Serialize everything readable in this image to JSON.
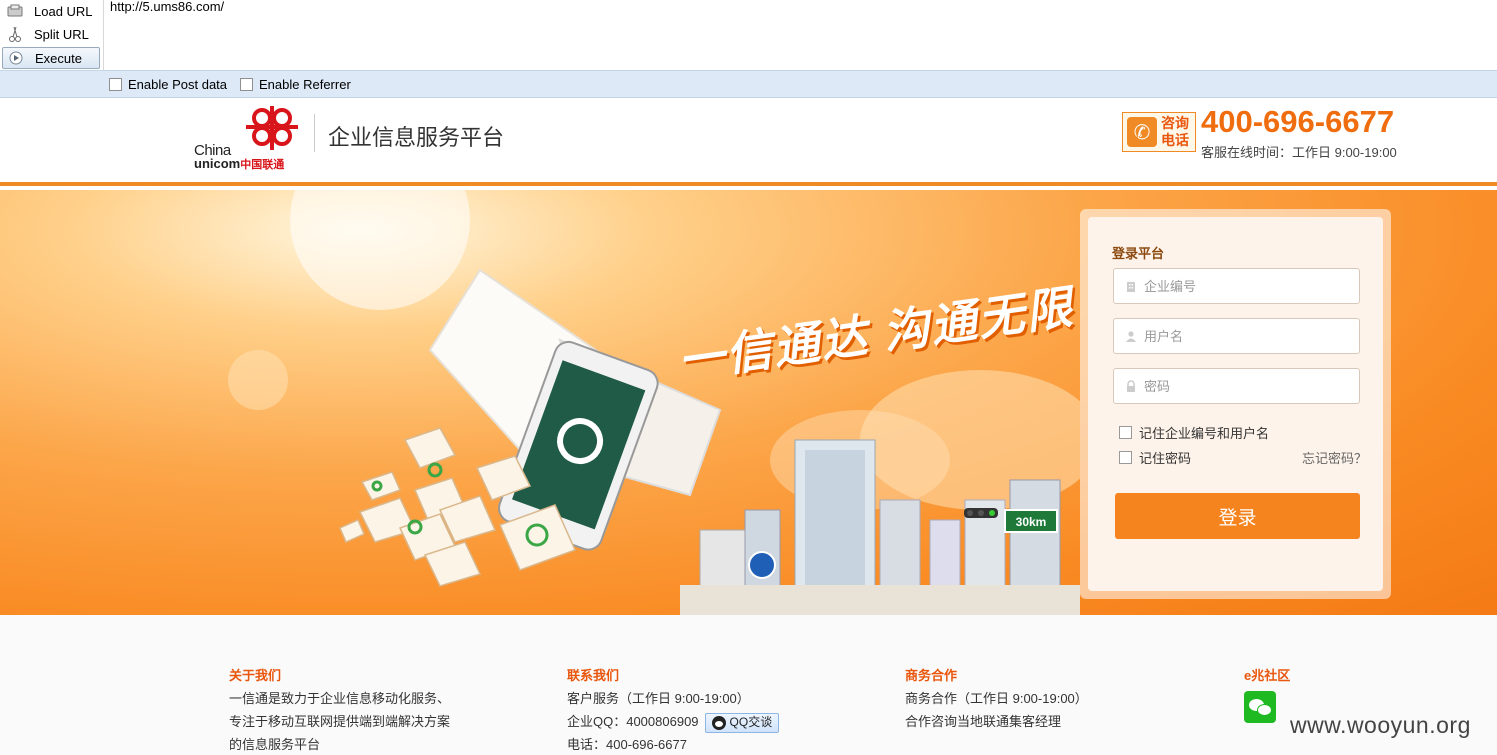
{
  "hackbar": {
    "load_label": "Load URL",
    "split_label": "Split URL",
    "execute_label": "Execute",
    "url": "http://5.ums86.com/",
    "post_label": "Enable Post data",
    "referrer_label": "Enable Referrer"
  },
  "header": {
    "logo_china": "China",
    "logo_unicom": "unicom",
    "logo_cn": "中国联通",
    "title": "企业信息服务平台",
    "hotline_tag_line1": "咨询",
    "hotline_tag_line2": "电话",
    "hotline_number": "400-696-6677",
    "hotline_hours": "客服在线时间：工作日 9:00-19:00"
  },
  "banner": {
    "slogan": "一信通达 沟通无限",
    "road_sign": "30km"
  },
  "login": {
    "title": "登录平台",
    "corp_placeholder": "企业编号",
    "user_placeholder": "用户名",
    "pass_placeholder": "密码",
    "remember_corp": "记住企业编号和用户名",
    "remember_pass": "记住密码",
    "forgot": "忘记密码？",
    "submit": "登录"
  },
  "footer": {
    "about": {
      "title": "关于我们",
      "lines": [
        "一信通是致力于企业信息移动化服务、",
        "专注于移动互联网提供端到端解决方案",
        "的信息服务平台"
      ]
    },
    "contact": {
      "title": "联系我们",
      "service": "客户服务（工作日 9:00-19:00）",
      "qq": "企业QQ：4000806909",
      "qq_button": "QQ交谈",
      "phone": "电话：400-696-6677"
    },
    "business": {
      "title": "商务合作",
      "line1": "商务合作（工作日 9:00-19:00）",
      "line2": "合作咨询当地联通集客经理"
    },
    "community": {
      "title": "e兆社区"
    },
    "watermark": "www.wooyun.org"
  },
  "colors": {
    "accent": "#f5841f",
    "hotline": "#ef6c0f",
    "footer_title": "#e8570d",
    "unicom_red": "#d8151a"
  }
}
